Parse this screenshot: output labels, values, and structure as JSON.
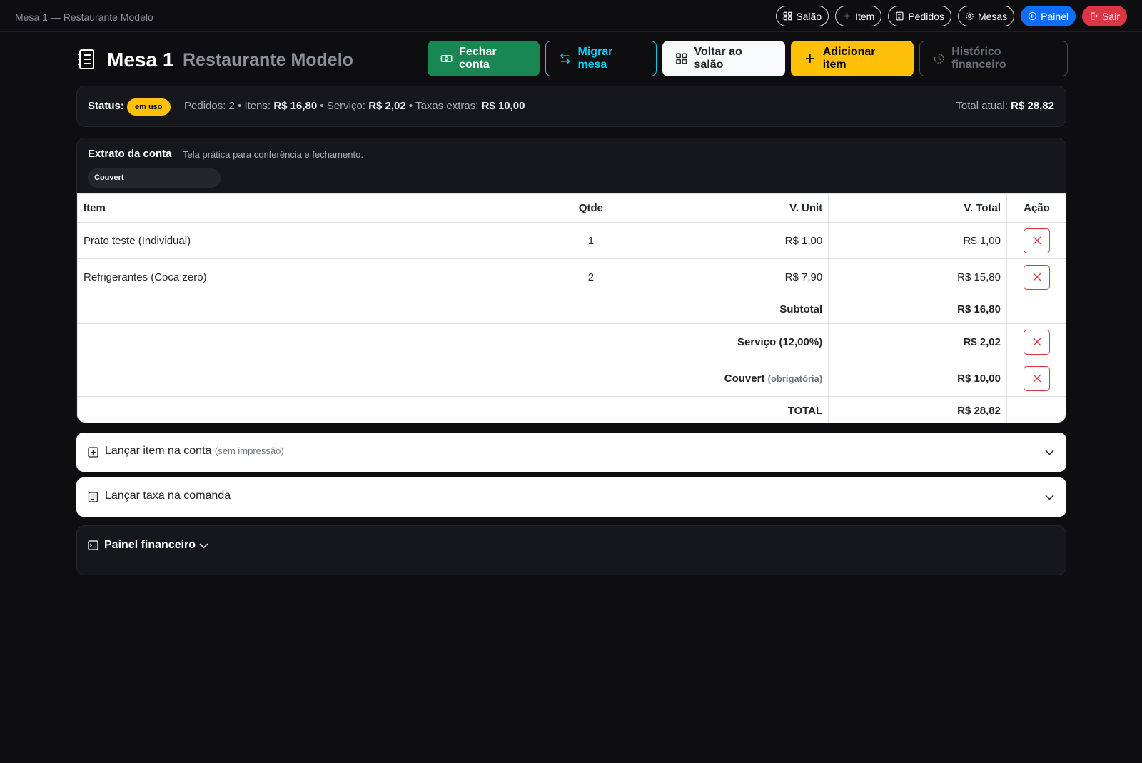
{
  "window_title": "Mesa 1 — Restaurante Modelo",
  "nav": {
    "salao": "Salão",
    "item": "Item",
    "pedidos": "Pedidos",
    "mesas": "Mesas",
    "painel": "Painel",
    "sair": "Sair"
  },
  "header": {
    "title": "Mesa 1",
    "subtitle": "Restaurante Modelo"
  },
  "actions": {
    "fechar": "Fechar conta",
    "migrar": "Migrar mesa",
    "voltar": "Voltar ao salão",
    "adicionar": "Adicionar item",
    "historico": "Histórico financeiro"
  },
  "status": {
    "label": "Status:",
    "badge": "em uso",
    "pedidos_label": "Pedidos:",
    "pedidos": "2",
    "itens_label": "Itens:",
    "itens": "R$ 16,80",
    "servico_label": "Serviço:",
    "servico": "R$ 2,02",
    "taxas_label": "Taxas extras:",
    "taxas": "R$ 10,00",
    "total_label": "Total atual:",
    "total": "R$ 28,82"
  },
  "extrato": {
    "title": "Extrato da conta",
    "subtitle": "Tela prática para conferência e fechamento.",
    "chip": "Couvert",
    "columns": [
      "Item",
      "Qtde",
      "V. Unit",
      "V. Total",
      "Ação"
    ],
    "rows": [
      {
        "item": "Prato teste (Individual)",
        "qtde": "1",
        "unit": "R$ 1,00",
        "total": "R$ 1,00"
      },
      {
        "item": "Refrigerantes (Coca zero)",
        "qtde": "2",
        "unit": "R$ 7,90",
        "total": "R$ 15,80"
      }
    ],
    "subtotal_label": "Subtotal",
    "subtotal": "R$ 16,80",
    "servico_label": "Serviço (12,00%)",
    "servico": "R$ 2,02",
    "couvert_label": "Couvert",
    "couvert_note": "(obrigatória)",
    "couvert": "R$ 10,00",
    "total_label": "TOTAL",
    "total": "R$ 28,82"
  },
  "lancar_item": {
    "label": "Lançar item na conta",
    "note": "(sem impressão)"
  },
  "lancar_taxa": {
    "label": "Lançar taxa na comanda"
  },
  "painel_fin": {
    "label": "Painel financeiro"
  },
  "colors": {
    "green": "#198754",
    "cyan": "#0dcaf0",
    "yellow": "#ffc107",
    "blue": "#0d6efd",
    "red": "#dc3545"
  }
}
